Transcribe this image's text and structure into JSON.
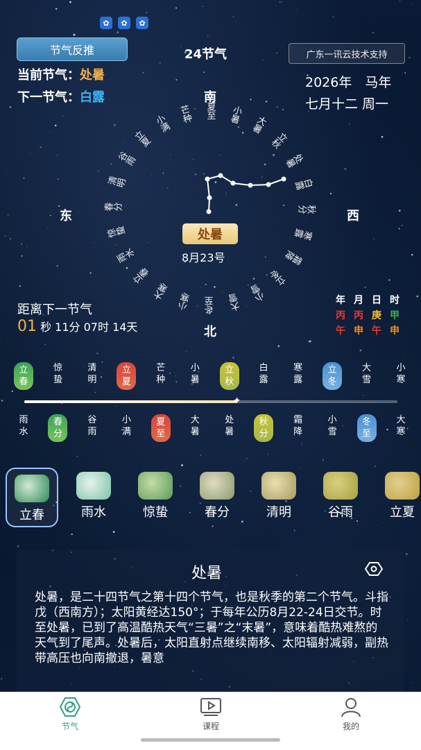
{
  "header": {
    "reverse_button": "节气反推",
    "title": "24节气",
    "support": "广东一讯云技术支持",
    "current_label": "当前节气：",
    "current_value": "处暑",
    "next_label": "下一节气：",
    "next_value": "白露",
    "year": "2026年　马年",
    "lunar": "七月十二 周一"
  },
  "compass": {
    "south": "南",
    "north": "北",
    "east": "东",
    "west": "西",
    "terms": [
      "夏至",
      "小暑",
      "大暑",
      "立秋",
      "处暑",
      "白露",
      "秋分",
      "寒露",
      "霜降",
      "立冬",
      "小雪",
      "大雪",
      "冬至",
      "小寒",
      "大寒",
      "立春",
      "雨水",
      "惊蛰",
      "春分",
      "清明",
      "谷雨",
      "立夏",
      "小满",
      "芒种"
    ],
    "center_term": "处暑",
    "center_date": "8月23号"
  },
  "countdown": {
    "label": "距离下一节气",
    "seconds": "01",
    "rest": " 秒 11分 07时 14天"
  },
  "ganzhi": {
    "headers": [
      "年",
      "月",
      "日",
      "时"
    ],
    "stems": [
      "丙",
      "丙",
      "庚",
      "甲"
    ],
    "branches": [
      "午",
      "申",
      "午",
      "申"
    ],
    "colors": {
      "red": "#e8392e",
      "yellow": "#f5c02e",
      "green": "#3cb24a",
      "orange": "#f08a1c"
    }
  },
  "top_terms": [
    {
      "text": "立春",
      "pill": "green"
    },
    {
      "text": "惊蛰"
    },
    {
      "text": "清明"
    },
    {
      "text": "立夏",
      "pill": "red"
    },
    {
      "text": "芒种"
    },
    {
      "text": "小暑"
    },
    {
      "text": "立秋",
      "pill": "yellow"
    },
    {
      "text": "白露"
    },
    {
      "text": "寒露"
    },
    {
      "text": "立冬",
      "pill": "blue"
    },
    {
      "text": "大雪"
    },
    {
      "text": "小寒"
    }
  ],
  "bottom_terms": [
    {
      "text": "雨水"
    },
    {
      "text": "春分",
      "pill": "green"
    },
    {
      "text": "谷雨"
    },
    {
      "text": "小满"
    },
    {
      "text": "夏至",
      "pill": "red"
    },
    {
      "text": "大暑"
    },
    {
      "text": "处暑"
    },
    {
      "text": "秋分",
      "pill": "yellow"
    },
    {
      "text": "霜降"
    },
    {
      "text": "小雪"
    },
    {
      "text": "冬至",
      "pill": "blue"
    },
    {
      "text": "大寒"
    }
  ],
  "progress": 0.57,
  "thumbnails": [
    "立春",
    "雨水",
    "惊蛰",
    "春分",
    "清明",
    "谷雨",
    "立夏"
  ],
  "description": {
    "title": "处暑",
    "text": "处暑，是二十四节气之第十四个节气，也是秋季的第二个节气。斗指戊（西南方）；太阳黄经达150°；于每年公历8月22-24日交节。时至处暑，已到了高温酷热天气“三暑”之“末暑”，意味着酷热难熬的天气到了尾声。处暑后，太阳直射点继续南移、太阳辐射减弱，副热带高压也向南撤退，暑意"
  },
  "nav": {
    "tab1": "节气",
    "tab2": "课程",
    "tab3": "我的",
    "active_color": "#2e9e83"
  }
}
